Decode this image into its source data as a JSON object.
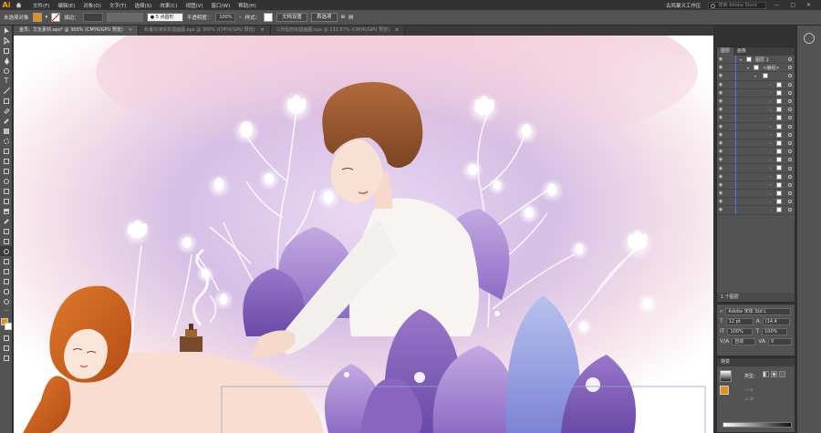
{
  "app": {
    "logo": "Ai",
    "workspace": "古风聚义工作区",
    "stock_search_placeholder": "搜索 Adobe Stock"
  },
  "menus": [
    "文件(F)",
    "编辑(E)",
    "对象(O)",
    "文字(T)",
    "选择(S)",
    "效果(C)",
    "视图(V)",
    "窗口(W)",
    "帮助(H)"
  ],
  "control_bar": {
    "selection_label": "未选择对象",
    "fill_color": "#e38f1a",
    "stroke_label": "描边：",
    "brush_label": "5 点圆形",
    "opacity_label": "不透明度：",
    "opacity_value": "100%",
    "style_label": "样式：",
    "doc_setup_button": "文档设置",
    "preferences_button": "首选项"
  },
  "tabs": [
    {
      "label": "金员、艾灸素材.eps* @ 300% (CMYK/GPU 预览)",
      "active": true
    },
    {
      "label": "秋暑挖凍快扣插画图.eps @ 300% (CMYK/GPU 预览)",
      "active": false
    },
    {
      "label": "三伏贴伤扣插画图.eps @ 132.67% (CMYK/GPU 预览)",
      "active": false
    }
  ],
  "layers_panel": {
    "tabs": [
      "图层",
      "画板"
    ],
    "top_layer": "图层 1",
    "group_label": "<编组>",
    "footer": "1 个图层"
  },
  "character_panel": {
    "font": "Adobe 宋体 Std L",
    "size": "12 pt",
    "leading": "(14.4",
    "h_scale": "100%",
    "v_scale": "100%",
    "kerning": "自动",
    "tracking": "0"
  },
  "gradient_panel": {
    "title": "渐变",
    "type_label": "类型："
  },
  "colors": {
    "accent": "#e38f1a",
    "selection_blue": "#3f7fff"
  }
}
